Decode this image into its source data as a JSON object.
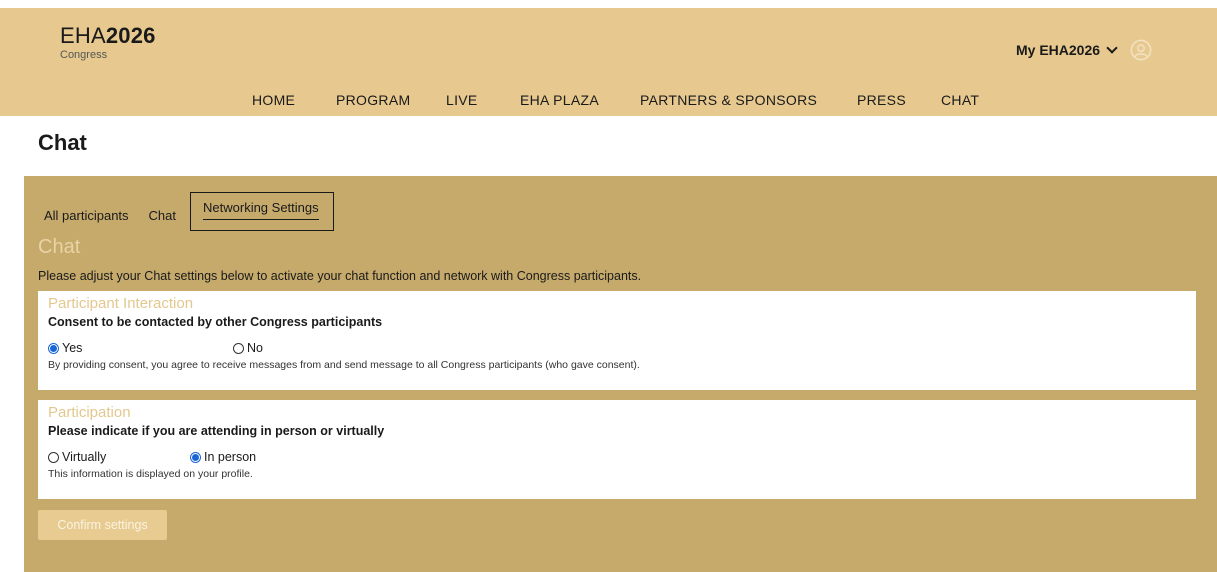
{
  "header": {
    "logo_prefix": "EHA",
    "logo_year": "2026",
    "logo_sub": "Congress",
    "my_eha_label": "My EHA2026",
    "icons": {
      "dropdown": "chevron-down-icon",
      "user": "user-circle-icon"
    }
  },
  "nav": {
    "items": [
      "HOME",
      "PROGRAM",
      "LIVE",
      "EHA PLAZA",
      "PARTNERS & SPONSORS",
      "PRESS",
      "CHAT"
    ]
  },
  "page": {
    "title": "Chat"
  },
  "tabs": {
    "items": [
      "All participants",
      "Chat",
      "Networking Settings"
    ],
    "active": "Networking Settings"
  },
  "settings": {
    "heading": "Chat",
    "description": "Please adjust your Chat settings below to activate your chat function and network with Congress participants.",
    "interaction": {
      "title": "Participant Interaction",
      "question": "Consent to be contacted by other Congress participants",
      "options": [
        "Yes",
        "No"
      ],
      "selected": "Yes",
      "note": "By providing consent, you agree to receive messages from and send message to all Congress participants (who gave consent)."
    },
    "participation": {
      "title": "Participation",
      "question": "Please indicate if you are attending in person or virtually",
      "options": [
        "Virtually",
        "In person"
      ],
      "selected": "In person",
      "note": "This information is displayed on your profile."
    },
    "confirm_label": "Confirm settings"
  },
  "colors": {
    "header_bg": "#e7c98f",
    "panel_bg": "#c6aa6c",
    "accent_text": "#e3c88e",
    "radio_selected": "#1a66d4"
  }
}
